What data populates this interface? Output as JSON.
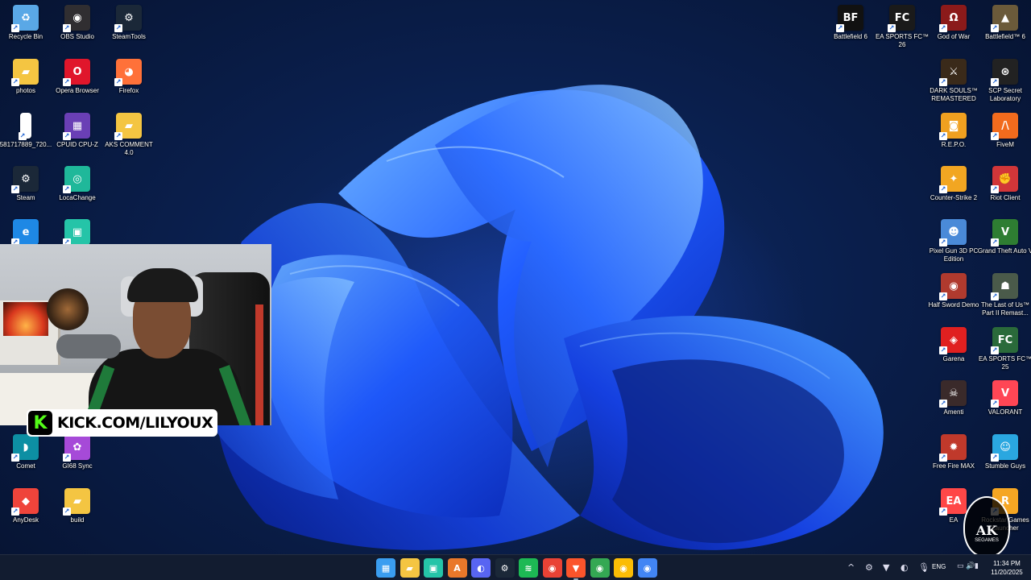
{
  "desktop": {
    "left_icons": [
      {
        "name": "recycle-bin-icon",
        "label": "Recycle Bin",
        "glyph": "♻",
        "color": "#5aa8e6"
      },
      {
        "name": "obs-studio-icon",
        "label": "OBS Studio",
        "glyph": "◉",
        "color": "#302e31"
      },
      {
        "name": "steamtools-icon",
        "label": "SteamTools",
        "glyph": "⚙",
        "color": "#1b2838"
      },
      {
        "name": "photos-folder-icon",
        "label": "photos",
        "glyph": "▰",
        "color": "#f4c542"
      },
      {
        "name": "opera-browser-icon",
        "label": "Opera Browser",
        "glyph": "O",
        "color": "#e0162b"
      },
      {
        "name": "firefox-icon",
        "label": "Firefox",
        "glyph": "◕",
        "color": "#ff7139"
      },
      {
        "name": "image-file-icon",
        "label": "581717889_720...",
        "glyph": "",
        "color": "#ffffff"
      },
      {
        "name": "cpuid-cpu-z-icon",
        "label": "CPUID CPU-Z",
        "glyph": "▦",
        "color": "#6a3fb5"
      },
      {
        "name": "aks-comment-folder-icon",
        "label": "AKS COMMENT 4.0",
        "glyph": "▰",
        "color": "#f4c542"
      },
      {
        "name": "steam-icon",
        "label": "Steam",
        "glyph": "⚙",
        "color": "#1b2838"
      },
      {
        "name": "locachange-icon",
        "label": "LocaChange",
        "glyph": "◎",
        "color": "#1fb89a"
      },
      {
        "name": "edge-icon",
        "label": "",
        "glyph": "e",
        "color": "#1e88e5"
      },
      {
        "name": "app-teal-icon",
        "label": "",
        "glyph": "▣",
        "color": "#25c4a8"
      },
      {
        "name": "comet-icon",
        "label": "Comet",
        "glyph": "◗",
        "color": "#0d8fa3"
      },
      {
        "name": "gi68-sync-icon",
        "label": "GI68 Sync",
        "glyph": "✿",
        "color": "#a64ad8"
      },
      {
        "name": "anydesk-icon",
        "label": "AnyDesk",
        "glyph": "◆",
        "color": "#ef443b"
      },
      {
        "name": "build-folder-icon",
        "label": "build",
        "glyph": "▰",
        "color": "#f4c542"
      }
    ],
    "right_icons": [
      {
        "name": "battlefield-6-icon",
        "label": "Battlefield 6",
        "glyph": "BF",
        "color": "#111111"
      },
      {
        "name": "ea-sports-fc-26-icon",
        "label": "EA SPORTS FC™ 26",
        "glyph": "FC",
        "color": "#1a1a1a"
      },
      {
        "name": "god-of-war-icon",
        "label": "God of War",
        "glyph": "Ω",
        "color": "#8b1a1a"
      },
      {
        "name": "battlefield-6-alt-icon",
        "label": "Battlefield™ 6",
        "glyph": "▲",
        "color": "#6b5a3a"
      },
      {
        "name": "dark-souls-icon",
        "label": "DARK SOULS™ REMASTERED",
        "glyph": "⚔",
        "color": "#3a2a1a"
      },
      {
        "name": "scp-secret-laboratory-icon",
        "label": "SCP Secret Laboratory",
        "glyph": "⊛",
        "color": "#222222"
      },
      {
        "name": "repo-icon",
        "label": "R.E.P.O.",
        "glyph": "◙",
        "color": "#f0a020"
      },
      {
        "name": "fivem-icon",
        "label": "FiveM",
        "glyph": "/\\",
        "color": "#f26b1d"
      },
      {
        "name": "counter-strike-2-icon",
        "label": "Counter-Strike 2",
        "glyph": "✦",
        "color": "#f2a622"
      },
      {
        "name": "riot-client-icon",
        "label": "Riot Client",
        "glyph": "✊",
        "color": "#d13639"
      },
      {
        "name": "pixel-gun-3d-icon",
        "label": "Pixel Gun 3D PC Edition",
        "glyph": "☻",
        "color": "#4a8ad8"
      },
      {
        "name": "gta-v-icon",
        "label": "Grand Theft Auto V",
        "glyph": "V",
        "color": "#2e7d32"
      },
      {
        "name": "half-sword-icon",
        "label": "Half Sword Demo",
        "glyph": "◉",
        "color": "#b03a2e"
      },
      {
        "name": "last-of-us-icon",
        "label": "The Last of Us™ Part II Remast...",
        "glyph": "☗",
        "color": "#4a5a4a"
      },
      {
        "name": "garena-icon",
        "label": "Garena",
        "glyph": "◈",
        "color": "#e02020"
      },
      {
        "name": "ea-sports-fc-25-icon",
        "label": "EA SPORTS FC™ 25",
        "glyph": "FC",
        "color": "#2a6a3a"
      },
      {
        "name": "amenti-icon",
        "label": "Amenti",
        "glyph": "☠",
        "color": "#3a2a2a"
      },
      {
        "name": "valorant-icon",
        "label": "VALORANT",
        "glyph": "V",
        "color": "#ff4655"
      },
      {
        "name": "free-fire-max-icon",
        "label": "Free Fire MAX",
        "glyph": "✹",
        "color": "#c0392b"
      },
      {
        "name": "stumble-guys-icon",
        "label": "Stumble Guys",
        "glyph": "☺",
        "color": "#2aa7e0"
      },
      {
        "name": "ea-icon",
        "label": "EA",
        "glyph": "EA",
        "color": "#ff4747"
      },
      {
        "name": "rockstar-games-launcher-icon",
        "label": "Rockstar Games Launcher",
        "glyph": "R",
        "color": "#f5a623"
      }
    ]
  },
  "overlay": {
    "kick_text": "KICK.COM/LILYOUX",
    "kick_logo": "K",
    "watermark_main": "AK",
    "watermark_sub": "SEGAMES"
  },
  "taskbar": {
    "apps": [
      {
        "name": "start-button",
        "glyph": "▦",
        "color": "#3a9df0"
      },
      {
        "name": "file-explorer-icon",
        "glyph": "▰",
        "color": "#f4c542"
      },
      {
        "name": "taskbar-app-teal-icon",
        "glyph": "▣",
        "color": "#25c4a8"
      },
      {
        "name": "taskbar-app-orange-icon",
        "glyph": "A",
        "color": "#e9782a"
      },
      {
        "name": "discord-icon",
        "glyph": "◐",
        "color": "#5865f2"
      },
      {
        "name": "steam-taskbar-icon",
        "glyph": "⚙",
        "color": "#1b2838"
      },
      {
        "name": "spotify-icon",
        "glyph": "≋",
        "color": "#1db954"
      },
      {
        "name": "chrome-icon",
        "glyph": "◉",
        "color": "#e94235"
      },
      {
        "name": "brave-icon",
        "glyph": "▼",
        "color": "#fb542b"
      },
      {
        "name": "chrome-profile-1-icon",
        "glyph": "◉",
        "color": "#34a853"
      },
      {
        "name": "chrome-profile-2-icon",
        "glyph": "◉",
        "color": "#fbbc05"
      },
      {
        "name": "chrome-profile-3-icon",
        "glyph": "◉",
        "color": "#4285f4"
      }
    ],
    "tray_icons": [
      {
        "name": "show-hidden-icons-icon",
        "glyph": "^"
      },
      {
        "name": "steam-tray-icon",
        "glyph": "⚙"
      },
      {
        "name": "nvidia-tray-icon",
        "glyph": "▼"
      },
      {
        "name": "discord-tray-icon",
        "glyph": "◐"
      },
      {
        "name": "microphone-icon",
        "glyph": "🎙"
      }
    ],
    "language": "ENG",
    "system_icons": [
      {
        "name": "monitor-icon",
        "glyph": "▭"
      },
      {
        "name": "speaker-icon",
        "glyph": "🔊"
      },
      {
        "name": "battery-icon",
        "glyph": "▮"
      }
    ],
    "time": "11:34 PM",
    "date": "11/20/2025"
  }
}
